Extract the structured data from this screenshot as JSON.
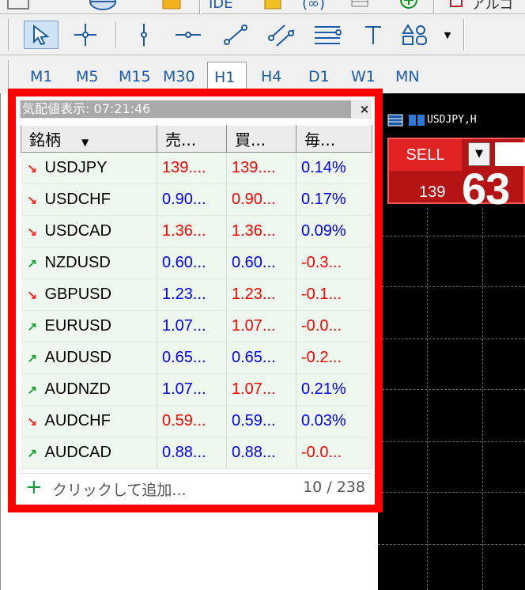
{
  "toolbar_top": {
    "items": [
      {
        "name": "chart-icon",
        "label": ""
      },
      {
        "name": "globe-icon",
        "label": ""
      },
      {
        "name": "folder-icon",
        "label": ""
      },
      {
        "name": "ide-button",
        "label": "IDE"
      },
      {
        "name": "autotrading-icon",
        "label": ""
      },
      {
        "name": "ellipsis-label",
        "label": "(∞)"
      },
      {
        "name": "new-order-icon",
        "label": ""
      },
      {
        "name": "algo-label",
        "label": "アルゴ"
      }
    ]
  },
  "drawing_tools": [
    {
      "name": "cursor-icon"
    },
    {
      "name": "crosshair-icon"
    },
    {
      "name": "vertical-line-icon"
    },
    {
      "name": "horizontal-line-icon"
    },
    {
      "name": "trendline-icon"
    },
    {
      "name": "parallel-channel-icon"
    },
    {
      "name": "fibonacci-icon"
    },
    {
      "name": "text-icon"
    },
    {
      "name": "shapes-icon"
    },
    {
      "name": "dropdown-icon"
    }
  ],
  "timeframes": [
    "M1",
    "M5",
    "M15",
    "M30",
    "H1",
    "H4",
    "D1",
    "W1",
    "MN"
  ],
  "active_timeframe": "H1",
  "market_watch": {
    "title": "気配値表示: 07:21:46",
    "close": "×",
    "columns": {
      "symbol": "銘柄",
      "sort_arrow": "▼",
      "bid": "売...",
      "ask": "買...",
      "daily": "毎..."
    },
    "rows": [
      {
        "dir": "down",
        "arrow": "↘",
        "symbol": "USDJPY",
        "bid": "139....",
        "bid_color": "red",
        "ask": "139....",
        "ask_color": "red",
        "change": "0.14%",
        "change_color": "blue"
      },
      {
        "dir": "down",
        "arrow": "↘",
        "symbol": "USDCHF",
        "bid": "0.90...",
        "bid_color": "blue",
        "ask": "0.90...",
        "ask_color": "red",
        "change": "0.17%",
        "change_color": "blue"
      },
      {
        "dir": "down",
        "arrow": "↘",
        "symbol": "USDCAD",
        "bid": "1.36...",
        "bid_color": "red",
        "ask": "1.36...",
        "ask_color": "red",
        "change": "0.09%",
        "change_color": "blue"
      },
      {
        "dir": "up",
        "arrow": "↗",
        "symbol": "NZDUSD",
        "bid": "0.60...",
        "bid_color": "blue",
        "ask": "0.60...",
        "ask_color": "blue",
        "change": "-0.3...",
        "change_color": "red"
      },
      {
        "dir": "down",
        "arrow": "↘",
        "symbol": "GBPUSD",
        "bid": "1.23...",
        "bid_color": "blue",
        "ask": "1.23...",
        "ask_color": "red",
        "change": "-0.1...",
        "change_color": "red"
      },
      {
        "dir": "up",
        "arrow": "↗",
        "symbol": "EURUSD",
        "bid": "1.07...",
        "bid_color": "blue",
        "ask": "1.07...",
        "ask_color": "red",
        "change": "-0.0...",
        "change_color": "red"
      },
      {
        "dir": "up",
        "arrow": "↗",
        "symbol": "AUDUSD",
        "bid": "0.65...",
        "bid_color": "blue",
        "ask": "0.65...",
        "ask_color": "blue",
        "change": "-0.2...",
        "change_color": "red"
      },
      {
        "dir": "up",
        "arrow": "↗",
        "symbol": "AUDNZD",
        "bid": "1.07...",
        "bid_color": "blue",
        "ask": "1.07...",
        "ask_color": "red",
        "change": "0.21%",
        "change_color": "blue"
      },
      {
        "dir": "down",
        "arrow": "↘",
        "symbol": "AUDCHF",
        "bid": "0.59...",
        "bid_color": "red",
        "ask": "0.59...",
        "ask_color": "blue",
        "change": "0.03%",
        "change_color": "blue"
      },
      {
        "dir": "up",
        "arrow": "↗",
        "symbol": "AUDCAD",
        "bid": "0.88...",
        "bid_color": "blue",
        "ask": "0.88...",
        "ask_color": "blue",
        "change": "-0.0...",
        "change_color": "red"
      }
    ],
    "add_plus": "+",
    "add_label": "クリックして追加...",
    "count": "10 / 238"
  },
  "chart": {
    "header": "USDJPY,H",
    "sell_label": "SELL",
    "price_small": "139",
    "price_big": "63",
    "dropdown": "▼"
  },
  "colors": {
    "frame": "#ff0000",
    "red": "#ff0000",
    "blue": "#0000ff",
    "up": "#1a9a3a",
    "down": "#ff2020",
    "sell": "#e02424"
  }
}
